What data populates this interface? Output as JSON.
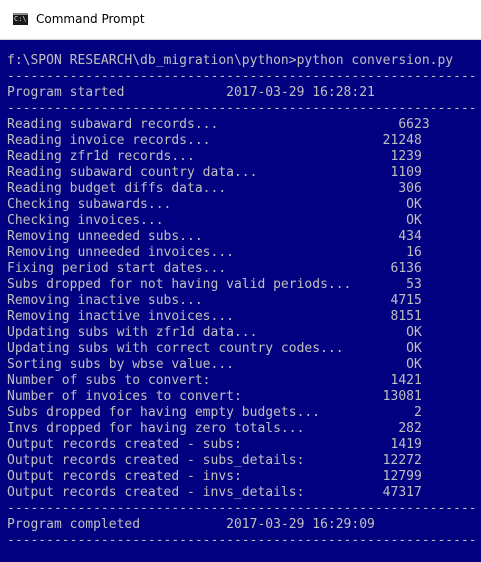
{
  "window": {
    "title": "Command Prompt",
    "icon": "cmd-icon",
    "icon_glyph": "C:\\",
    "console_bg": "#000080",
    "console_fg": "#c0c0c0"
  },
  "console": {
    "lines": [
      "f:\\SPON RESEARCH\\db_migration\\python>python conversion.py",
      "------------------------------------------------------------",
      "Program started             2017-03-29 16:28:21",
      "------------------------------------------------------------",
      "Reading subaward records...                       6623",
      "Reading invoice records...                      21248",
      "Reading zfr1d records...                         1239",
      "Reading subaward country data...                 1109",
      "Reading budget diffs data...                      306",
      "Checking subawards...                              OK",
      "Checking invoices...                               OK",
      "Removing unneeded subs...                         434",
      "Removing unneeded invoices...                      16",
      "Fixing period start dates...                     6136",
      "Subs dropped for not having valid periods...       53",
      "Removing inactive subs...                        4715",
      "Removing inactive invoices...                    8151",
      "Updating subs with zfr1d data...                   OK",
      "Updating subs with correct country codes...        OK",
      "Sorting subs by wbse value...                      OK",
      "Number of subs to convert:                       1421",
      "Number of invoices to convert:                  13081",
      "Subs dropped for having empty budgets...            2",
      "Invs dropped for having zero totals...            282",
      "Output records created - subs:                   1419",
      "Output records created - subs_details:          12272",
      "Output records created - invs:                  12799",
      "Output records created - invs_details:          47317",
      "------------------------------------------------------------",
      "Program completed           2017-03-29 16:29:09",
      "------------------------------------------------------------"
    ]
  }
}
